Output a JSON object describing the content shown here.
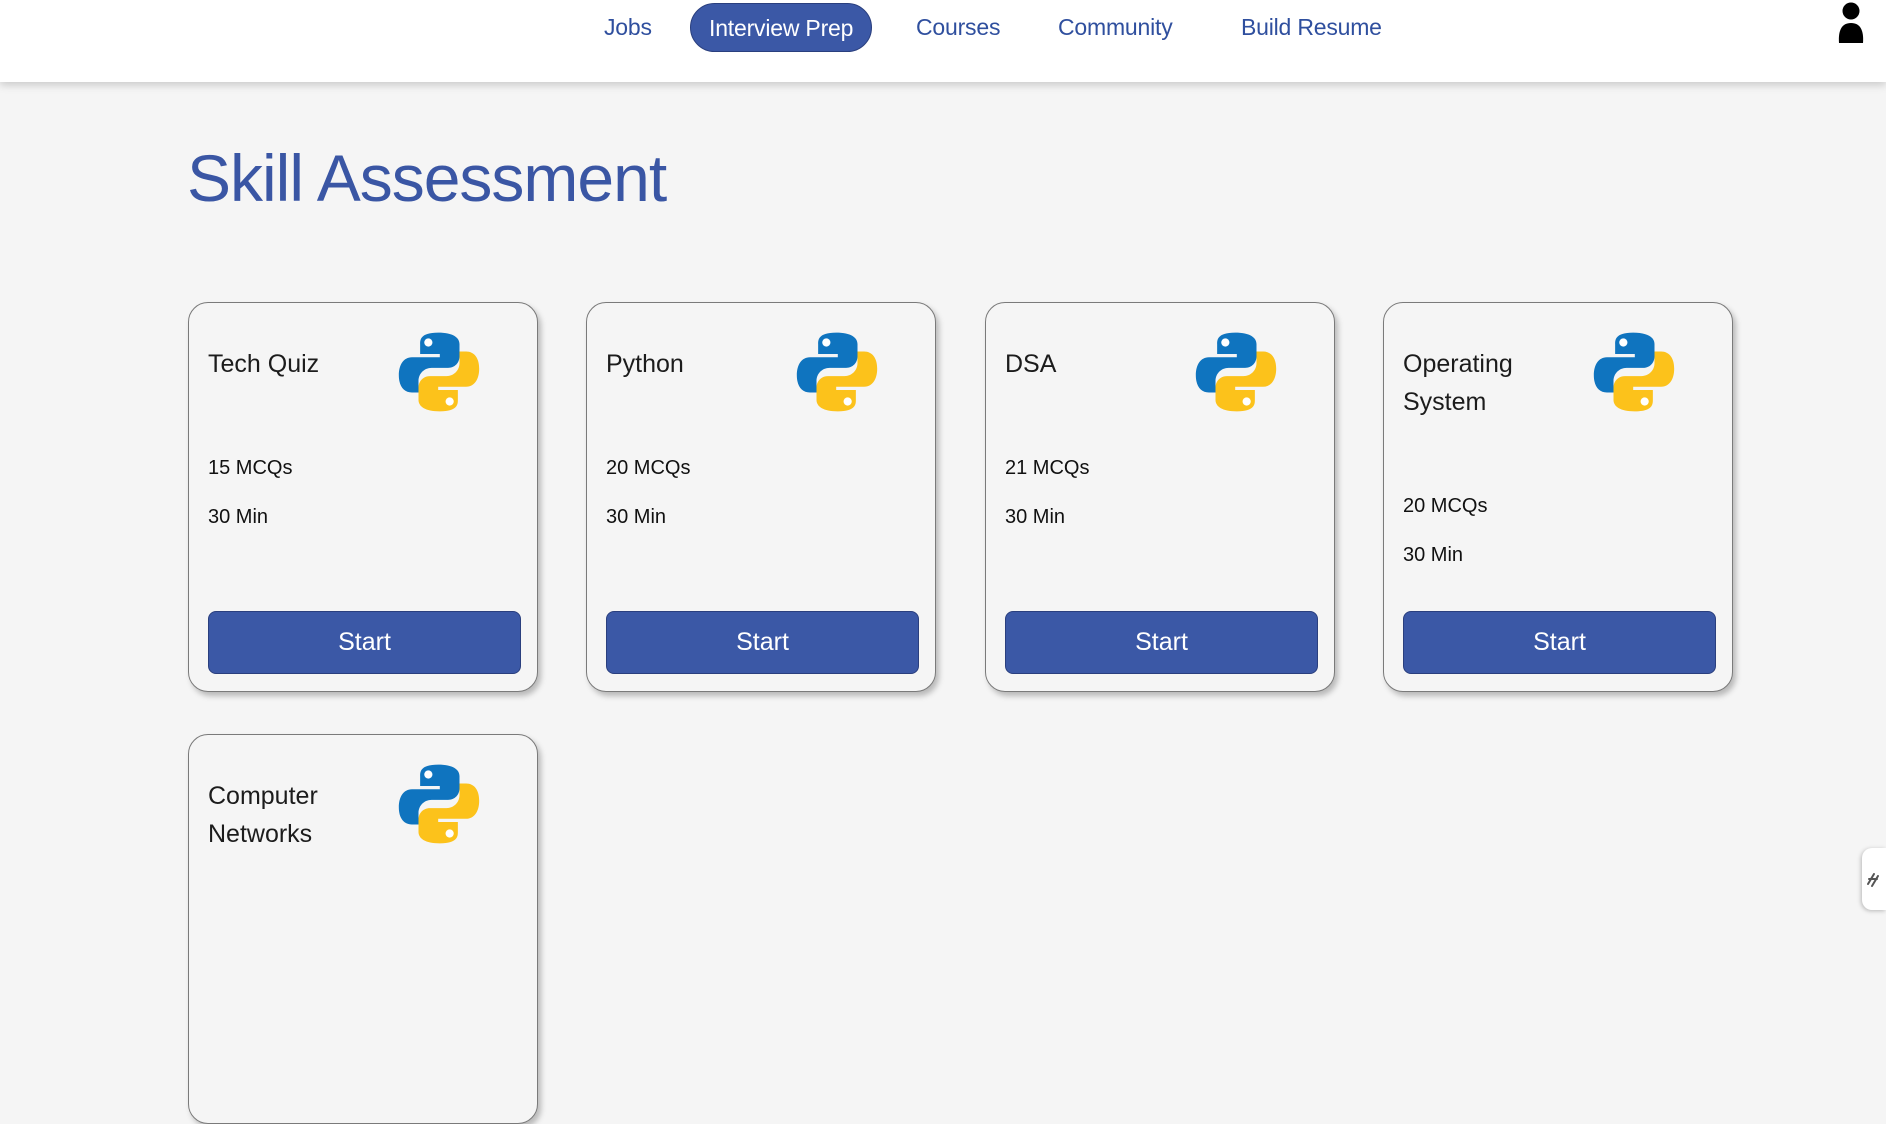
{
  "nav": {
    "items": [
      {
        "label": "Jobs",
        "active": false
      },
      {
        "label": "Interview Prep",
        "active": true
      },
      {
        "label": "Courses",
        "active": false
      },
      {
        "label": "Community",
        "active": false
      },
      {
        "label": "Build Resume",
        "active": false
      }
    ],
    "profile_icon": "user-icon"
  },
  "page": {
    "title": "Skill Assessment"
  },
  "cards": [
    {
      "title": "Tech Quiz",
      "mcqs": "15 MCQs",
      "duration": "30 Min",
      "button": "Start",
      "icon": "python-logo-icon"
    },
    {
      "title": "Python",
      "mcqs": "20 MCQs",
      "duration": "30 Min",
      "button": "Start",
      "icon": "python-logo-icon"
    },
    {
      "title": "DSA",
      "mcqs": "21 MCQs",
      "duration": "30 Min",
      "button": "Start",
      "icon": "python-logo-icon"
    },
    {
      "title": "Operating System",
      "mcqs": "20 MCQs",
      "duration": "30 Min",
      "button": "Start",
      "icon": "python-logo-icon"
    },
    {
      "title": "Computer Networks",
      "icon": "python-logo-icon"
    }
  ],
  "colors": {
    "accent": "#3b58a6",
    "nav_text": "#2f4f9e",
    "background": "#f5f5f5",
    "python_blue": "#0f74bf",
    "python_yellow": "#fcc21b"
  }
}
